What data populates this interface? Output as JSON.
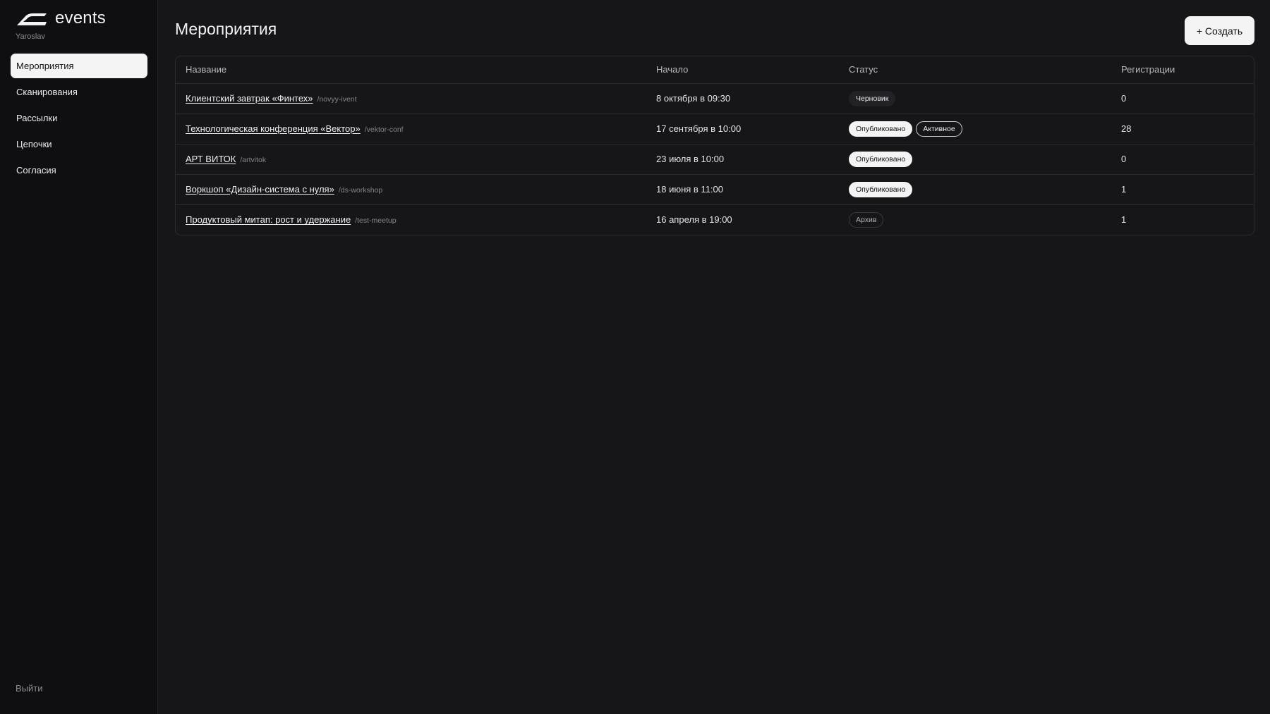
{
  "brand": {
    "name": "events",
    "user": "Yaroslav"
  },
  "sidebar": {
    "items": [
      {
        "label": "Мероприятия",
        "active": true
      },
      {
        "label": "Сканирования",
        "active": false
      },
      {
        "label": "Рассылки",
        "active": false
      },
      {
        "label": "Цепочки",
        "active": false
      },
      {
        "label": "Согласия",
        "active": false
      }
    ],
    "logout_label": "Выйти"
  },
  "header": {
    "title": "Мероприятия",
    "create_label": "+ Создать"
  },
  "table": {
    "columns": [
      "Название",
      "Начало",
      "Статус",
      "Регистрации"
    ],
    "rows": [
      {
        "name": "Клиентский завтрак «Финтех»",
        "slug": "/novyy-ivent",
        "start": "8 октября в 09:30",
        "badges": [
          {
            "label": "Черновик",
            "kind": "draft"
          }
        ],
        "registrations": "0"
      },
      {
        "name": "Технологическая конференция «Вектор»",
        "slug": "/vektor-conf",
        "start": "17 сентября в 10:00",
        "badges": [
          {
            "label": "Опубликовано",
            "kind": "published"
          },
          {
            "label": "Активное",
            "kind": "active"
          }
        ],
        "registrations": "28"
      },
      {
        "name": "АРТ ВИТОК",
        "slug": "/artvitok",
        "start": "23 июля в 10:00",
        "badges": [
          {
            "label": "Опубликовано",
            "kind": "published"
          }
        ],
        "registrations": "0"
      },
      {
        "name": "Воркшоп «Дизайн-система с нуля»",
        "slug": "/ds-workshop",
        "start": "18 июня в 11:00",
        "badges": [
          {
            "label": "Опубликовано",
            "kind": "published"
          }
        ],
        "registrations": "1"
      },
      {
        "name": "Продуктовый митап: рост и удержание",
        "slug": "/test-meetup",
        "start": "16 апреля в 19:00",
        "badges": [
          {
            "label": "Архив",
            "kind": "archive"
          }
        ],
        "registrations": "1"
      }
    ]
  },
  "colors": {
    "background": "#161618",
    "sidebar": "#0f0f11",
    "accent_light": "#f4f4f5",
    "border": "#2b2b2f",
    "muted_text": "#8d8d92"
  },
  "icons": {
    "logo": "events-logo-icon"
  }
}
